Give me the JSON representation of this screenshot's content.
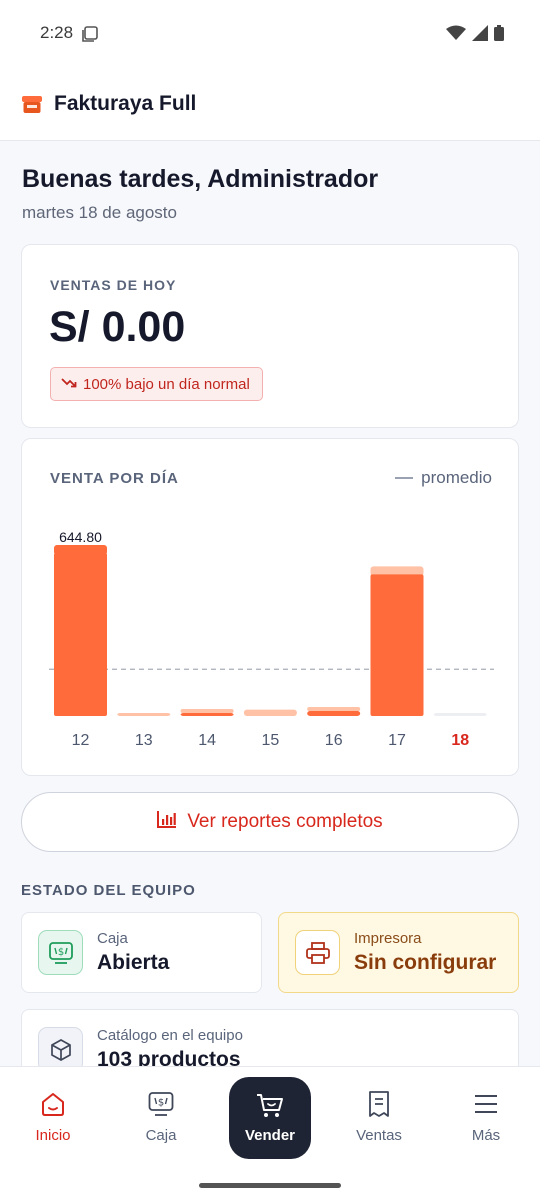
{
  "status_bar": {
    "time": "2:28"
  },
  "app_bar": {
    "title": "Fakturaya Full"
  },
  "greeting": {
    "title": "Buenas tardes, Administrador",
    "date": "martes 18 de agosto"
  },
  "sales_today": {
    "label": "VENTAS DE HOY",
    "amount": "S/ 0.00",
    "badge": "100% bajo un día normal",
    "badge_color": "#c0261e"
  },
  "chart": {
    "title": "VENTA POR DÍA",
    "legend_label": "promedio",
    "highlight_label": "644.80"
  },
  "chart_data": {
    "type": "bar",
    "title": "VENTA POR DÍA",
    "categories": [
      "12",
      "13",
      "14",
      "15",
      "16",
      "17",
      "18"
    ],
    "values": [
      644.8,
      12,
      8,
      25,
      20,
      560,
      0
    ],
    "average_line": 185,
    "ylim": [
      0,
      700
    ],
    "highlight_category": "18",
    "bar_color": "#ff6b3a",
    "muted_color": "#ffc2a6",
    "highlight_label_color": "#d8281d"
  },
  "reports_button": {
    "label": "Ver reportes completos"
  },
  "equipment": {
    "section_title": "ESTADO DEL EQUIPO",
    "caja": {
      "label": "Caja",
      "value": "Abierta"
    },
    "printer": {
      "label": "Impresora",
      "value": "Sin configurar"
    },
    "catalog": {
      "label": "Catálogo en el equipo",
      "value": "103 productos"
    }
  },
  "bottom_nav": {
    "items": [
      {
        "label": "Inicio",
        "icon": "home-icon",
        "active": true
      },
      {
        "label": "Caja",
        "icon": "register-icon"
      },
      {
        "label": "Vender",
        "icon": "cart-icon"
      },
      {
        "label": "Ventas",
        "icon": "receipt-icon"
      },
      {
        "label": "Más",
        "icon": "menu-icon"
      }
    ]
  },
  "colors": {
    "accent": "#d8281d",
    "bar": "#ff6b3a",
    "dark": "#1f2434"
  }
}
